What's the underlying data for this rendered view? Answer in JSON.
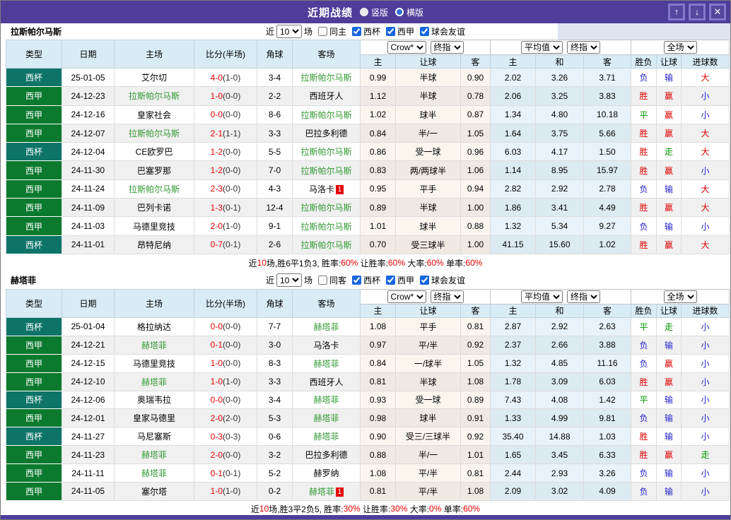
{
  "colors": {
    "titlebar": "#4e3d99",
    "type_badges": {
      "西杯": "#0e7468",
      "西甲": "#0b7a2e"
    },
    "focus_team_green": "#339933",
    "score_red": "#e60000",
    "win_red": "#dd0000",
    "lose_blue": "#2222cc",
    "draw_green": "#009900"
  },
  "titlebar": {
    "title": "近期战绩",
    "radios": [
      {
        "label": "竖版",
        "selected": true
      },
      {
        "label": "横版",
        "selected": false
      }
    ],
    "buttons": {
      "up": "↑",
      "down": "↓",
      "close": "✕"
    }
  },
  "table_header": {
    "type": "类型",
    "date": "日期",
    "home": "主场",
    "score": "比分(半场)",
    "corner": "角球",
    "away": "客场",
    "asian": {
      "home": "主",
      "handicap": "让球",
      "away": "客"
    },
    "europe": {
      "home": "主",
      "draw": "和",
      "away": "客"
    },
    "result": {
      "wdl": "胜负",
      "handicap": "让球",
      "goals": "进球数"
    },
    "dropdowns": {
      "provider": "Crow*",
      "final_a": "终指",
      "average": "平均值",
      "final_b": "终指",
      "fulltime": "全场"
    }
  },
  "sections": [
    {
      "team": "拉斯帕尔马斯",
      "filter": {
        "prefix": "近",
        "count": "10",
        "suffix": "场",
        "same": {
          "label": "同主",
          "checked": false
        },
        "leagues": [
          {
            "label": "西杯",
            "checked": true
          },
          {
            "label": "西甲",
            "checked": true
          },
          {
            "label": "球会友谊",
            "checked": true
          }
        ]
      },
      "rows": [
        {
          "type": "西杯",
          "date": "25-01-05",
          "home": "艾尔切",
          "home_focus": false,
          "score": "4-0",
          "half": "(1-0)",
          "corner": "3-4",
          "away": "拉斯帕尔马斯",
          "away_focus": true,
          "away_card": "",
          "asian": [
            "0.99",
            "半球",
            "0.90"
          ],
          "europe": [
            "2.02",
            "3.26",
            "3.71"
          ],
          "result": [
            {
              "text": "负",
              "color": "blue"
            },
            {
              "text": "输",
              "color": "blue"
            },
            {
              "text": "大",
              "color": "red"
            }
          ]
        },
        {
          "type": "西甲",
          "date": "24-12-23",
          "home": "拉斯帕尔马斯",
          "home_focus": true,
          "score": "1-0",
          "half": "(0-0)",
          "corner": "2-2",
          "away": "西班牙人",
          "away_focus": false,
          "away_card": "",
          "asian": [
            "1.12",
            "半球",
            "0.78"
          ],
          "europe": [
            "2.06",
            "3.25",
            "3.83"
          ],
          "result": [
            {
              "text": "胜",
              "color": "red"
            },
            {
              "text": "赢",
              "color": "red"
            },
            {
              "text": "小",
              "color": "blue"
            }
          ]
        },
        {
          "type": "西甲",
          "date": "24-12-16",
          "home": "皇家社会",
          "home_focus": false,
          "score": "0-0",
          "half": "(0-0)",
          "corner": "8-6",
          "away": "拉斯帕尔马斯",
          "away_focus": true,
          "away_card": "",
          "asian": [
            "1.02",
            "球半",
            "0.87"
          ],
          "europe": [
            "1.34",
            "4.80",
            "10.18"
          ],
          "result": [
            {
              "text": "平",
              "color": "green"
            },
            {
              "text": "赢",
              "color": "red"
            },
            {
              "text": "小",
              "color": "blue"
            }
          ]
        },
        {
          "type": "西甲",
          "date": "24-12-07",
          "home": "拉斯帕尔马斯",
          "home_focus": true,
          "score": "2-1",
          "half": "(1-1)",
          "corner": "3-3",
          "away": "巴拉多利德",
          "away_focus": false,
          "away_card": "",
          "asian": [
            "0.84",
            "半/一",
            "1.05"
          ],
          "europe": [
            "1.64",
            "3.75",
            "5.66"
          ],
          "result": [
            {
              "text": "胜",
              "color": "red"
            },
            {
              "text": "赢",
              "color": "red"
            },
            {
              "text": "大",
              "color": "red"
            }
          ]
        },
        {
          "type": "西杯",
          "date": "24-12-04",
          "home": "CE欧罗巴",
          "home_focus": false,
          "score": "1-2",
          "half": "(0-0)",
          "corner": "5-5",
          "away": "拉斯帕尔马斯",
          "away_focus": true,
          "away_card": "",
          "asian": [
            "0.86",
            "受一球",
            "0.96"
          ],
          "europe": [
            "6.03",
            "4.17",
            "1.50"
          ],
          "result": [
            {
              "text": "胜",
              "color": "red"
            },
            {
              "text": "走",
              "color": "green"
            },
            {
              "text": "大",
              "color": "red"
            }
          ]
        },
        {
          "type": "西甲",
          "date": "24-11-30",
          "home": "巴塞罗那",
          "home_focus": false,
          "score": "1-2",
          "half": "(0-0)",
          "corner": "7-0",
          "away": "拉斯帕尔马斯",
          "away_focus": true,
          "away_card": "",
          "asian": [
            "0.83",
            "两/两球半",
            "1.06"
          ],
          "europe": [
            "1.14",
            "8.95",
            "15.97"
          ],
          "result": [
            {
              "text": "胜",
              "color": "red"
            },
            {
              "text": "赢",
              "color": "red"
            },
            {
              "text": "小",
              "color": "blue"
            }
          ]
        },
        {
          "type": "西甲",
          "date": "24-11-24",
          "home": "拉斯帕尔马斯",
          "home_focus": true,
          "score": "2-3",
          "half": "(0-0)",
          "corner": "4-3",
          "away": "马洛卡",
          "away_focus": false,
          "away_card": "1",
          "asian": [
            "0.95",
            "平手",
            "0.94"
          ],
          "europe": [
            "2.82",
            "2.92",
            "2.78"
          ],
          "result": [
            {
              "text": "负",
              "color": "blue"
            },
            {
              "text": "输",
              "color": "blue"
            },
            {
              "text": "大",
              "color": "red"
            }
          ]
        },
        {
          "type": "西甲",
          "date": "24-11-09",
          "home": "巴列卡诺",
          "home_focus": false,
          "score": "1-3",
          "half": "(0-1)",
          "corner": "12-4",
          "away": "拉斯帕尔马斯",
          "away_focus": true,
          "away_card": "",
          "asian": [
            "0.89",
            "半球",
            "1.00"
          ],
          "europe": [
            "1.86",
            "3.41",
            "4.49"
          ],
          "result": [
            {
              "text": "胜",
              "color": "red"
            },
            {
              "text": "赢",
              "color": "red"
            },
            {
              "text": "大",
              "color": "red"
            }
          ]
        },
        {
          "type": "西甲",
          "date": "24-11-03",
          "home": "马德里竞技",
          "home_focus": false,
          "score": "2-0",
          "half": "(1-0)",
          "corner": "9-1",
          "away": "拉斯帕尔马斯",
          "away_focus": true,
          "away_card": "",
          "asian": [
            "1.01",
            "球半",
            "0.88"
          ],
          "europe": [
            "1.32",
            "5.34",
            "9.27"
          ],
          "result": [
            {
              "text": "负",
              "color": "blue"
            },
            {
              "text": "输",
              "color": "blue"
            },
            {
              "text": "小",
              "color": "blue"
            }
          ]
        },
        {
          "type": "西杯",
          "date": "24-11-01",
          "home": "昂特尼纳",
          "home_focus": false,
          "score": "0-7",
          "half": "(0-1)",
          "corner": "2-6",
          "away": "拉斯帕尔马斯",
          "away_focus": true,
          "away_card": "",
          "asian": [
            "0.70",
            "受三球半",
            "1.00"
          ],
          "europe": [
            "41.15",
            "15.60",
            "1.02"
          ],
          "result": [
            {
              "text": "胜",
              "color": "red"
            },
            {
              "text": "赢",
              "color": "red"
            },
            {
              "text": "大",
              "color": "red"
            }
          ]
        }
      ],
      "summary": [
        {
          "text": "近",
          "red": false
        },
        {
          "text": "10",
          "red": true
        },
        {
          "text": "场,胜6平1负3, ",
          "red": false
        },
        {
          "text": "胜率:",
          "red": false
        },
        {
          "text": "60%",
          "red": true
        },
        {
          "text": " 让胜率:",
          "red": false
        },
        {
          "text": "60%",
          "red": true
        },
        {
          "text": " 大率:",
          "red": false
        },
        {
          "text": "60%",
          "red": true
        },
        {
          "text": " 单率:",
          "red": false
        },
        {
          "text": "60%",
          "red": true
        }
      ]
    },
    {
      "team": "赫塔菲",
      "filter": {
        "prefix": "近",
        "count": "10",
        "suffix": "场",
        "same": {
          "label": "同客",
          "checked": false
        },
        "leagues": [
          {
            "label": "西杯",
            "checked": true
          },
          {
            "label": "西甲",
            "checked": true
          },
          {
            "label": "球会友谊",
            "checked": true
          }
        ]
      },
      "rows": [
        {
          "type": "西杯",
          "date": "25-01-04",
          "home": "格拉纳达",
          "home_focus": false,
          "score": "0-0",
          "half": "(0-0)",
          "corner": "7-7",
          "away": "赫塔菲",
          "away_focus": true,
          "away_card": "",
          "asian": [
            "1.08",
            "平手",
            "0.81"
          ],
          "europe": [
            "2.87",
            "2.92",
            "2.63"
          ],
          "result": [
            {
              "text": "平",
              "color": "green"
            },
            {
              "text": "走",
              "color": "green"
            },
            {
              "text": "小",
              "color": "blue"
            }
          ]
        },
        {
          "type": "西甲",
          "date": "24-12-21",
          "home": "赫塔菲",
          "home_focus": true,
          "score": "0-1",
          "half": "(0-0)",
          "corner": "3-0",
          "away": "马洛卡",
          "away_focus": false,
          "away_card": "",
          "asian": [
            "0.97",
            "平/半",
            "0.92"
          ],
          "europe": [
            "2.37",
            "2.66",
            "3.88"
          ],
          "result": [
            {
              "text": "负",
              "color": "blue"
            },
            {
              "text": "输",
              "color": "blue"
            },
            {
              "text": "小",
              "color": "blue"
            }
          ]
        },
        {
          "type": "西甲",
          "date": "24-12-15",
          "home": "马德里竞技",
          "home_focus": false,
          "score": "1-0",
          "half": "(0-0)",
          "corner": "8-3",
          "away": "赫塔菲",
          "away_focus": true,
          "away_card": "",
          "asian": [
            "0.84",
            "一/球半",
            "1.05"
          ],
          "europe": [
            "1.32",
            "4.85",
            "11.16"
          ],
          "result": [
            {
              "text": "负",
              "color": "blue"
            },
            {
              "text": "赢",
              "color": "red"
            },
            {
              "text": "小",
              "color": "blue"
            }
          ]
        },
        {
          "type": "西甲",
          "date": "24-12-10",
          "home": "赫塔菲",
          "home_focus": true,
          "score": "1-0",
          "half": "(1-0)",
          "corner": "3-3",
          "away": "西班牙人",
          "away_focus": false,
          "away_card": "",
          "asian": [
            "0.81",
            "半球",
            "1.08"
          ],
          "europe": [
            "1.78",
            "3.09",
            "6.03"
          ],
          "result": [
            {
              "text": "胜",
              "color": "red"
            },
            {
              "text": "赢",
              "color": "red"
            },
            {
              "text": "小",
              "color": "blue"
            }
          ]
        },
        {
          "type": "西杯",
          "date": "24-12-06",
          "home": "奥瑞韦拉",
          "home_focus": false,
          "score": "0-0",
          "half": "(0-0)",
          "corner": "3-4",
          "away": "赫塔菲",
          "away_focus": true,
          "away_card": "",
          "asian": [
            "0.93",
            "受一球",
            "0.89"
          ],
          "europe": [
            "7.43",
            "4.08",
            "1.42"
          ],
          "result": [
            {
              "text": "平",
              "color": "green"
            },
            {
              "text": "输",
              "color": "blue"
            },
            {
              "text": "小",
              "color": "blue"
            }
          ]
        },
        {
          "type": "西甲",
          "date": "24-12-01",
          "home": "皇家马德里",
          "home_focus": false,
          "score": "2-0",
          "half": "(2-0)",
          "corner": "5-3",
          "away": "赫塔菲",
          "away_focus": true,
          "away_card": "",
          "asian": [
            "0.98",
            "球半",
            "0.91"
          ],
          "europe": [
            "1.33",
            "4.99",
            "9.81"
          ],
          "result": [
            {
              "text": "负",
              "color": "blue"
            },
            {
              "text": "输",
              "color": "blue"
            },
            {
              "text": "小",
              "color": "blue"
            }
          ]
        },
        {
          "type": "西杯",
          "date": "24-11-27",
          "home": "马尼塞斯",
          "home_focus": false,
          "score": "0-3",
          "half": "(0-3)",
          "corner": "0-6",
          "away": "赫塔菲",
          "away_focus": true,
          "away_card": "",
          "asian": [
            "0.90",
            "受三/三球半",
            "0.92"
          ],
          "europe": [
            "35.40",
            "14.88",
            "1.03"
          ],
          "result": [
            {
              "text": "胜",
              "color": "red"
            },
            {
              "text": "输",
              "color": "blue"
            },
            {
              "text": "小",
              "color": "blue"
            }
          ]
        },
        {
          "type": "西甲",
          "date": "24-11-23",
          "home": "赫塔菲",
          "home_focus": true,
          "score": "2-0",
          "half": "(0-0)",
          "corner": "3-2",
          "away": "巴拉多利德",
          "away_focus": false,
          "away_card": "",
          "asian": [
            "0.88",
            "半/一",
            "1.01"
          ],
          "europe": [
            "1.65",
            "3.45",
            "6.33"
          ],
          "result": [
            {
              "text": "胜",
              "color": "red"
            },
            {
              "text": "赢",
              "color": "red"
            },
            {
              "text": "走",
              "color": "green"
            }
          ]
        },
        {
          "type": "西甲",
          "date": "24-11-11",
          "home": "赫塔菲",
          "home_focus": true,
          "score": "0-1",
          "half": "(0-1)",
          "corner": "5-2",
          "away": "赫罗纳",
          "away_focus": false,
          "away_card": "",
          "asian": [
            "1.08",
            "平/半",
            "0.81"
          ],
          "europe": [
            "2.44",
            "2.93",
            "3.26"
          ],
          "result": [
            {
              "text": "负",
              "color": "blue"
            },
            {
              "text": "输",
              "color": "blue"
            },
            {
              "text": "小",
              "color": "blue"
            }
          ]
        },
        {
          "type": "西甲",
          "date": "24-11-05",
          "home": "塞尔塔",
          "home_focus": false,
          "score": "1-0",
          "half": "(1-0)",
          "corner": "0-2",
          "away": "赫塔菲",
          "away_focus": true,
          "away_card": "1",
          "asian": [
            "0.81",
            "平/半",
            "1.08"
          ],
          "europe": [
            "2.09",
            "3.02",
            "4.09"
          ],
          "result": [
            {
              "text": "负",
              "color": "blue"
            },
            {
              "text": "输",
              "color": "blue"
            },
            {
              "text": "小",
              "color": "blue"
            }
          ]
        }
      ],
      "summary": [
        {
          "text": "近",
          "red": false
        },
        {
          "text": "10",
          "red": true
        },
        {
          "text": "场,胜3平2负5, ",
          "red": false
        },
        {
          "text": "胜率:",
          "red": false
        },
        {
          "text": "30%",
          "red": true
        },
        {
          "text": " 让胜率:",
          "red": false
        },
        {
          "text": "30%",
          "red": true
        },
        {
          "text": " 大率:",
          "red": false
        },
        {
          "text": "0%",
          "red": true
        },
        {
          "text": " 单率:",
          "red": false
        },
        {
          "text": "60%",
          "red": true
        }
      ]
    }
  ]
}
